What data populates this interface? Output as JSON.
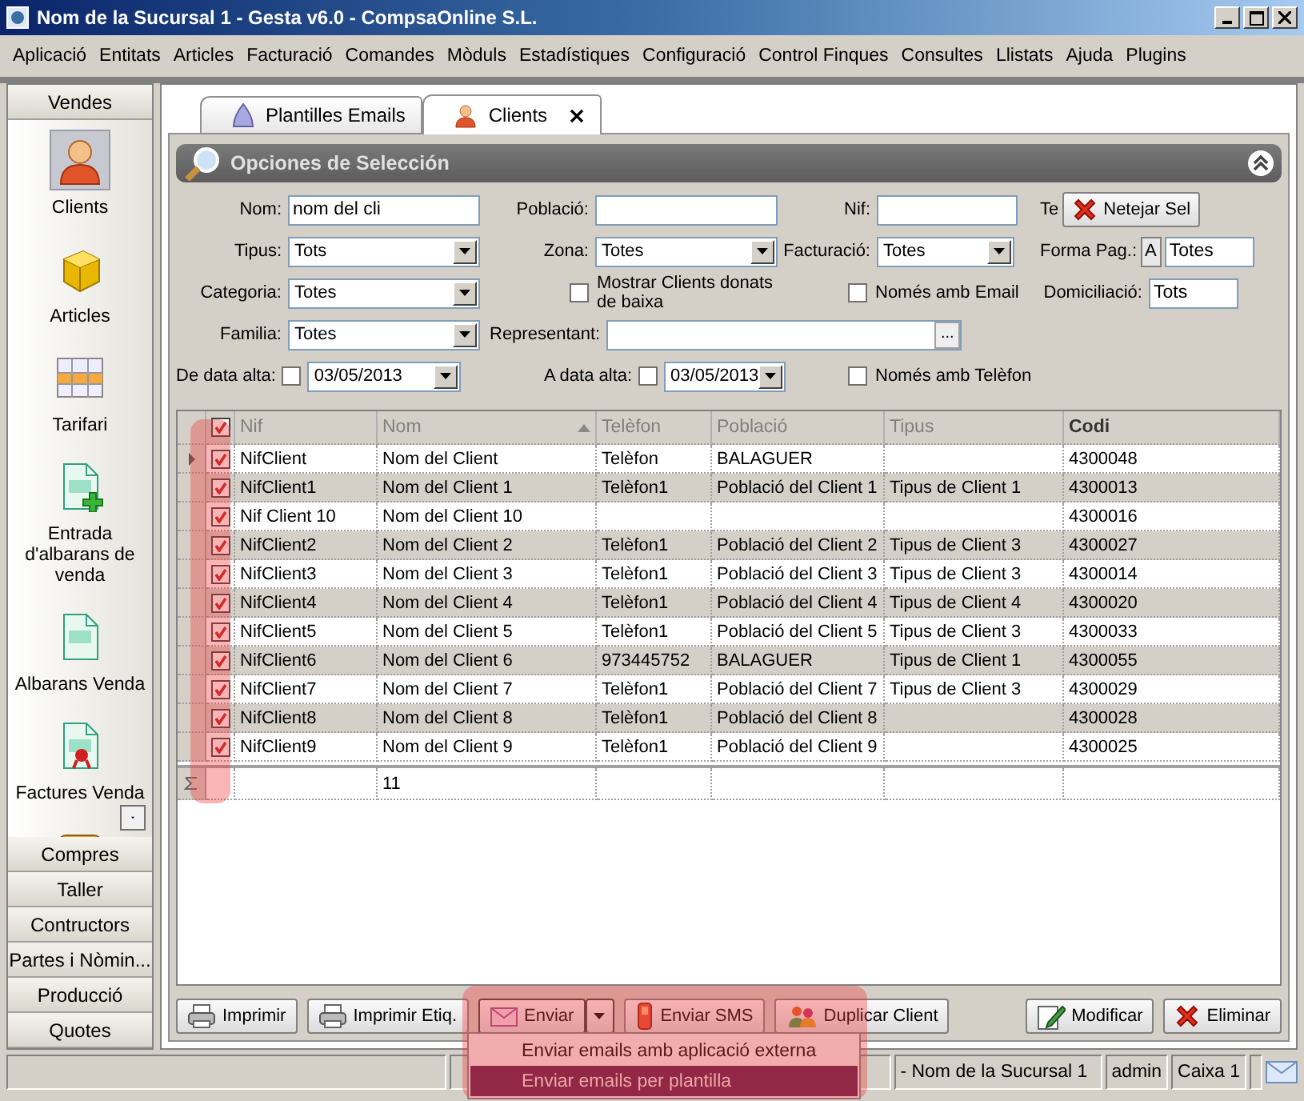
{
  "window": {
    "title": "Nom de la Sucursal 1 - Gesta v6.0 - CompsaOnline S.L."
  },
  "menu": [
    "Aplicació",
    "Entitats",
    "Articles",
    "Facturació",
    "Comandes",
    "Mòduls",
    "Estadístiques",
    "Configuració",
    "Control Finques",
    "Consultes",
    "Llistats",
    "Ajuda",
    "Plugins"
  ],
  "sidebar": {
    "groups": [
      {
        "label": "Vendes",
        "items": [
          {
            "kind": "person",
            "label": "Clients",
            "selected": true
          },
          {
            "kind": "cube",
            "label": "Articles",
            "selected": false
          },
          {
            "kind": "grid",
            "label": "Tarifari",
            "selected": false
          },
          {
            "kind": "doc-add",
            "label": "Entrada d'albarans de venda",
            "selected": false
          },
          {
            "kind": "doc",
            "label": "Albarans Venda",
            "selected": false
          },
          {
            "kind": "doc-seal",
            "label": "Factures Venda",
            "selected": false
          },
          {
            "kind": "folder",
            "selected": false
          }
        ]
      },
      {
        "label": "Compres"
      },
      {
        "label": "Taller"
      },
      {
        "label": "Contructors"
      },
      {
        "label": "Partes i Nòmin..."
      },
      {
        "label": "Producció"
      },
      {
        "label": "Quotes"
      }
    ]
  },
  "tabs": [
    {
      "kind": "template",
      "label": "Plantilles Emails",
      "selected": false,
      "closable": false
    },
    {
      "kind": "person",
      "label": "Clients",
      "selected": true,
      "closable": true
    }
  ],
  "filter": {
    "title": "Opciones de Selección",
    "expanded": true,
    "rows": [
      [
        {
          "kind": "text",
          "label": "Nom:",
          "value": "nom del cli"
        },
        {
          "kind": "text",
          "label": "Població:"
        },
        {
          "kind": "text",
          "label": "Nif:"
        },
        {
          "kind": "action",
          "label": "Te",
          "button": "Netejar Sel"
        }
      ],
      [
        {
          "kind": "combo",
          "label": "Tipus:",
          "value": "Tots"
        },
        {
          "kind": "combo",
          "label": "Zona:",
          "value": "Totes"
        },
        {
          "kind": "combo",
          "label": "Facturació:",
          "value": "Totes"
        },
        {
          "kind": "picker",
          "label": "Forma Pag.:",
          "button": "A",
          "value": "Totes"
        }
      ],
      [
        {
          "kind": "combo",
          "label": "Categoria:",
          "value": "Totes"
        },
        {
          "kind": "check",
          "label": "Mostrar Clients donats de baixa",
          "checked": false
        },
        {
          "kind": "check",
          "label": "Només amb Email",
          "checked": false
        },
        {
          "kind": "short",
          "label": "Domiciliació:",
          "value": "Tots"
        }
      ],
      [
        {
          "kind": "combo",
          "label": "Familia:",
          "value": "Totes"
        },
        {
          "kind": "lookup",
          "label": "Representant:",
          "button": "..."
        }
      ],
      [
        {
          "kind": "date",
          "label": "De data alta:",
          "checked": false,
          "value": "03/05/2013"
        },
        {
          "kind": "date",
          "label": "A data alta:",
          "checked": false,
          "value": "03/05/2013"
        },
        {
          "kind": "check",
          "label": "Només amb Telèfon",
          "checked": false
        }
      ]
    ]
  },
  "grid": {
    "all_checked": true,
    "columns": [
      {
        "label": "Nif",
        "highlighted": false,
        "sort_ascending": false
      },
      {
        "label": "Nom",
        "highlighted": false,
        "sort_ascending": true
      },
      {
        "label": "Telèfon",
        "highlighted": false,
        "sort_ascending": false
      },
      {
        "label": "Població",
        "highlighted": false,
        "sort_ascending": false
      },
      {
        "label": "Tipus",
        "highlighted": false,
        "sort_ascending": false
      },
      {
        "label": "Codi",
        "highlighted": true,
        "sort_ascending": false
      }
    ],
    "rows": [
      {
        "current": true,
        "checked": true,
        "cells": [
          "NifClient",
          "Nom del Client",
          "Telèfon",
          "BALAGUER",
          null,
          "4300048"
        ]
      },
      {
        "current": false,
        "checked": true,
        "cells": [
          "NifClient1",
          "Nom del Client 1",
          "Telèfon1",
          "Població del Client 1",
          "Tipus de Client 1",
          "4300013"
        ]
      },
      {
        "current": false,
        "checked": true,
        "cells": [
          "Nif Client 10",
          "Nom del Client 10",
          null,
          null,
          null,
          "4300016"
        ]
      },
      {
        "current": false,
        "checked": true,
        "cells": [
          "NifClient2",
          "Nom del Client 2",
          "Telèfon1",
          "Població del Client 2",
          "Tipus de Client 3",
          "4300027"
        ]
      },
      {
        "current": false,
        "checked": true,
        "cells": [
          "NifClient3",
          "Nom del Client 3",
          "Telèfon1",
          "Població del Client 3",
          "Tipus de Client 3",
          "4300014"
        ]
      },
      {
        "current": false,
        "checked": true,
        "cells": [
          "NifClient4",
          "Nom del Client 4",
          "Telèfon1",
          "Població del Client 4",
          "Tipus de Client 4",
          "4300020"
        ]
      },
      {
        "current": false,
        "checked": true,
        "cells": [
          "NifClient5",
          "Nom del Client 5",
          "Telèfon1",
          "Població del Client 5",
          "Tipus de Client 3",
          "4300033"
        ]
      },
      {
        "current": false,
        "checked": true,
        "cells": [
          "NifClient6",
          "Nom del Client 6",
          "973445752",
          "BALAGUER",
          "Tipus de Client 1",
          "4300055"
        ]
      },
      {
        "current": false,
        "checked": true,
        "cells": [
          "NifClient7",
          "Nom del Client 7",
          "Telèfon1",
          "Població del Client 7",
          "Tipus de Client 3",
          "4300029"
        ]
      },
      {
        "current": false,
        "checked": true,
        "cells": [
          "NifClient8",
          "Nom del Client 8",
          "Telèfon1",
          "Població del Client 8",
          null,
          "4300028"
        ]
      },
      {
        "current": false,
        "checked": true,
        "cells": [
          "NifClient9",
          "Nom del Client 9",
          "Telèfon1",
          "Població del Client 9",
          null,
          "4300025"
        ]
      }
    ],
    "summary_count": "11"
  },
  "buttons": [
    {
      "kind": "printer",
      "label": "Imprimir",
      "split": false
    },
    {
      "kind": "printer",
      "label": "Imprimir Etiq.",
      "split": false
    },
    {
      "kind": "mail",
      "label": "Enviar",
      "split": true
    },
    {
      "kind": "phone",
      "label": "Enviar SMS",
      "split": false
    },
    {
      "kind": "duplicate",
      "label": "Duplicar Client",
      "split": false
    }
  ],
  "right_buttons": [
    {
      "kind": "edit",
      "label": "Modificar"
    },
    {
      "kind": "delete",
      "label": "Eliminar"
    }
  ],
  "dropdown": {
    "open": true,
    "items": [
      {
        "label": "Enviar emails amb aplicació externa",
        "selected": false
      },
      {
        "label": "Enviar emails per plantilla",
        "selected": true
      }
    ]
  },
  "status_bar": [
    "- Nom de la Sucursal 1",
    "admin",
    "Caixa 1"
  ],
  "highlights": {
    "check_column": true,
    "send_area": true
  }
}
